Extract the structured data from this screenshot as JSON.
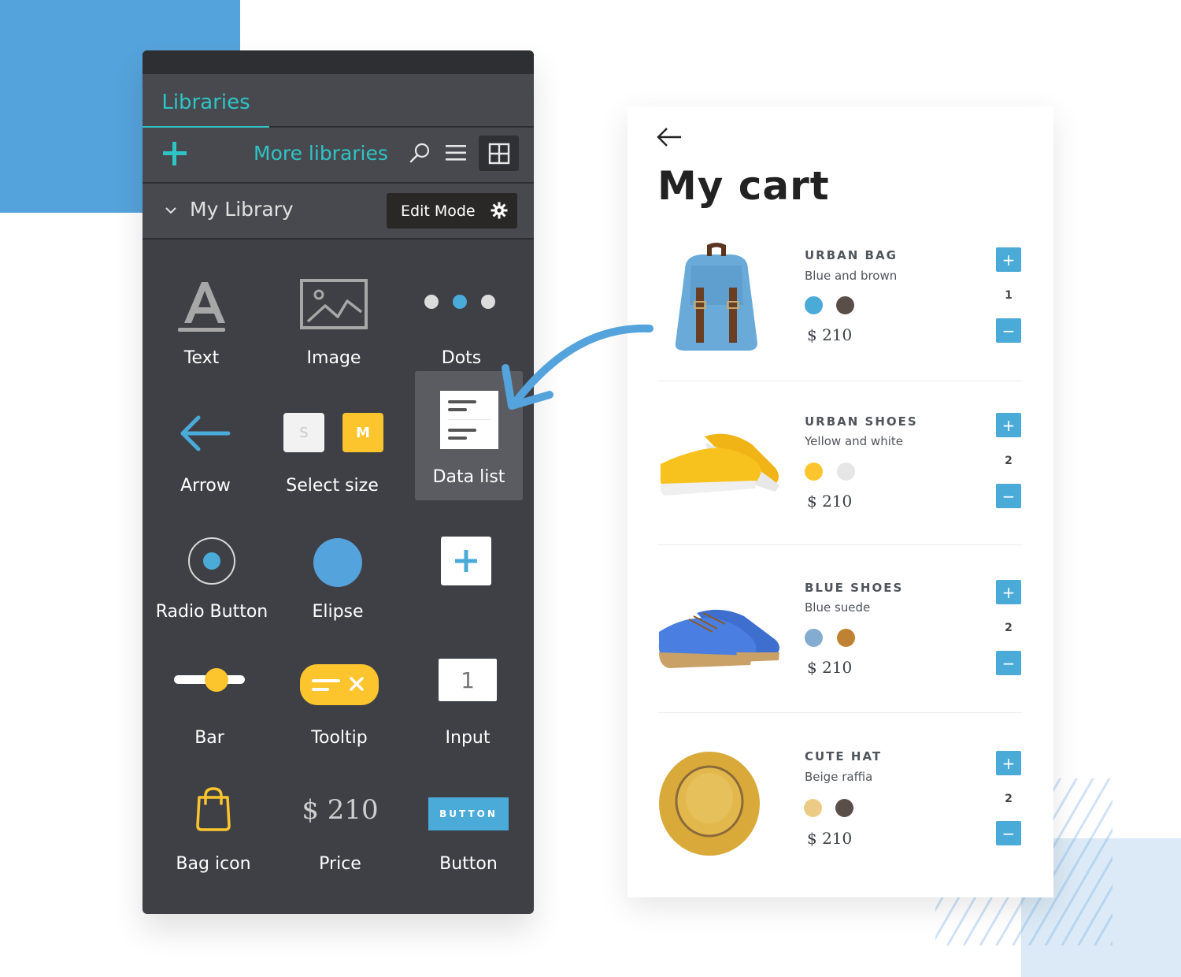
{
  "panel": {
    "tab_label": "Libraries",
    "toolbar": {
      "add_icon": "plus-icon",
      "more_libraries_label": "More libraries",
      "search_icon": "search-icon",
      "list_view_icon": "list-icon",
      "grid_view_icon": "grid-icon",
      "active_view": "grid"
    },
    "section": {
      "title": "My Library",
      "expanded": true,
      "edit_mode_label": "Edit Mode"
    },
    "items": [
      {
        "label": "Text",
        "icon": "text-icon"
      },
      {
        "label": "Image",
        "icon": "image-icon"
      },
      {
        "label": "Dots",
        "icon": "dots-icon"
      },
      {
        "label": "Arrow",
        "icon": "arrow-left-icon"
      },
      {
        "label": "Select size",
        "icon": "select-size-icon",
        "sizes": [
          "S",
          "M"
        ]
      },
      {
        "label": "Data list",
        "icon": "data-list-icon",
        "selected": true
      },
      {
        "label": "Radio Button",
        "icon": "radio-button-icon"
      },
      {
        "label": "Elipse",
        "icon": "ellipse-icon"
      },
      {
        "label": "",
        "icon": "add-box-icon"
      },
      {
        "label": "Bar",
        "icon": "slider-bar-icon"
      },
      {
        "label": "Tooltip",
        "icon": "tooltip-icon"
      },
      {
        "label": "Input",
        "icon": "input-icon",
        "value": "1"
      },
      {
        "label": "Bag icon",
        "icon": "bag-icon"
      },
      {
        "label": "Price",
        "icon": "price-icon",
        "value": "$ 210"
      },
      {
        "label": "Button",
        "icon": "button-icon",
        "button_text": "BUTTON"
      }
    ]
  },
  "cart": {
    "title": "My cart",
    "back_icon": "arrow-left-icon",
    "products": [
      {
        "name": "URBAN BAG",
        "description": "Blue and brown",
        "swatches": [
          "#4aaad8",
          "#5a4e48"
        ],
        "price": "$ 210",
        "quantity": "1",
        "image": "backpack"
      },
      {
        "name": "URBAN SHOES",
        "description": "Yellow and white",
        "swatches": [
          "#fcc52e",
          "#e6e6e6"
        ],
        "price": "$ 210",
        "quantity": "2",
        "image": "yellow-shoes"
      },
      {
        "name": "BLUE SHOES",
        "description": "Blue suede",
        "swatches": [
          "#84abd0",
          "#bf8232"
        ],
        "price": "$ 210",
        "quantity": "2",
        "image": "blue-shoes"
      },
      {
        "name": "CUTE HAT",
        "description": "Beige raffia",
        "swatches": [
          "#eccb86",
          "#5a4e48"
        ],
        "price": "$ 210",
        "quantity": "2",
        "image": "straw-hat"
      }
    ],
    "plus_label": "+",
    "minus_label": "−"
  },
  "colors": {
    "accent_teal": "#2ec4c6",
    "accent_blue": "#4aaad8",
    "accent_yellow": "#fcc52e",
    "panel_bg": "#3f4045"
  }
}
